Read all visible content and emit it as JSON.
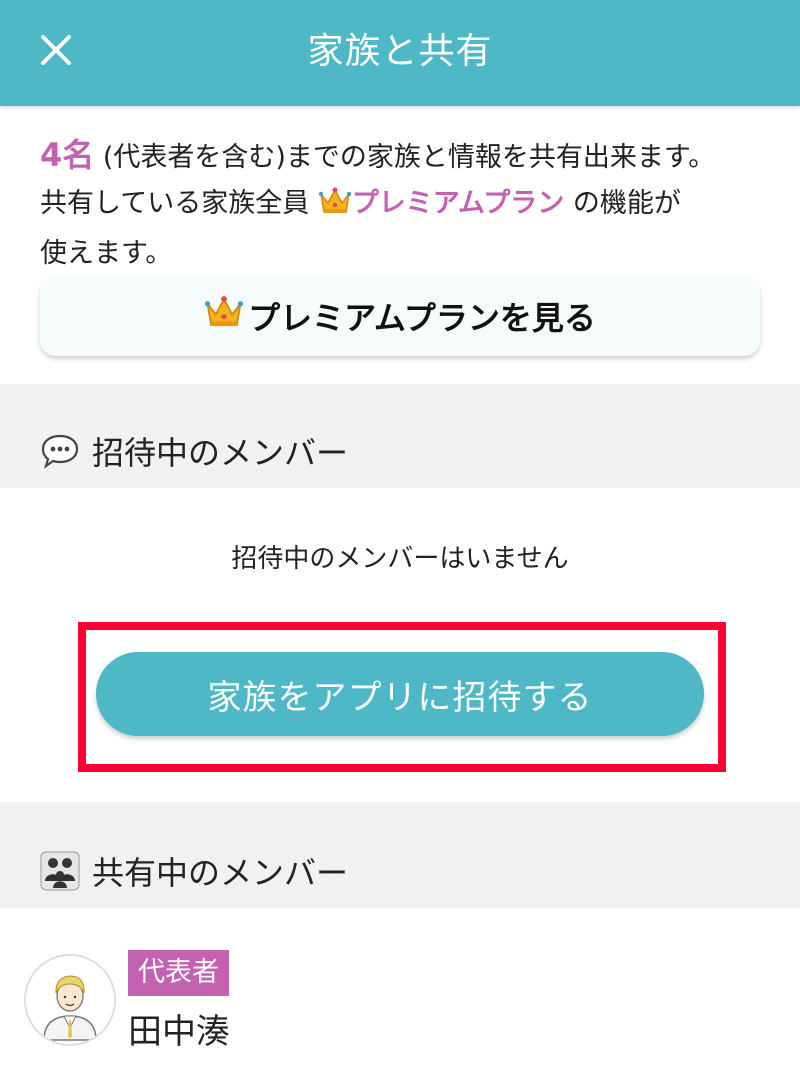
{
  "header": {
    "title": "家族と共有",
    "close_icon": "close-icon"
  },
  "intro": {
    "count": "4名",
    "line1_rest": " (代表者を含む)までの家族と情報を共有出来ます。",
    "line2_pre": "共有している家族全員 ",
    "plan_name": "プレミアムプラン",
    "line2_post": " の機能が",
    "line3": "使えます。"
  },
  "premium_button": {
    "label": "プレミアムプランを見る",
    "icon": "crown-icon"
  },
  "invited_section": {
    "title": "招待中のメンバー",
    "icon": "speech-bubble-icon",
    "empty_text": "招待中のメンバーはいません",
    "invite_button_label": "家族をアプリに招待する"
  },
  "sharing_section": {
    "title": "共有中のメンバー",
    "icon": "family-icon",
    "members": [
      {
        "role": "代表者",
        "name": "田中湊",
        "avatar": "avatar-man-icon"
      }
    ]
  },
  "colors": {
    "header": "#4fb8c7",
    "accent_purple": "#c462b2",
    "highlight_red": "#ff0033",
    "section_band": "#f1f1f1"
  }
}
